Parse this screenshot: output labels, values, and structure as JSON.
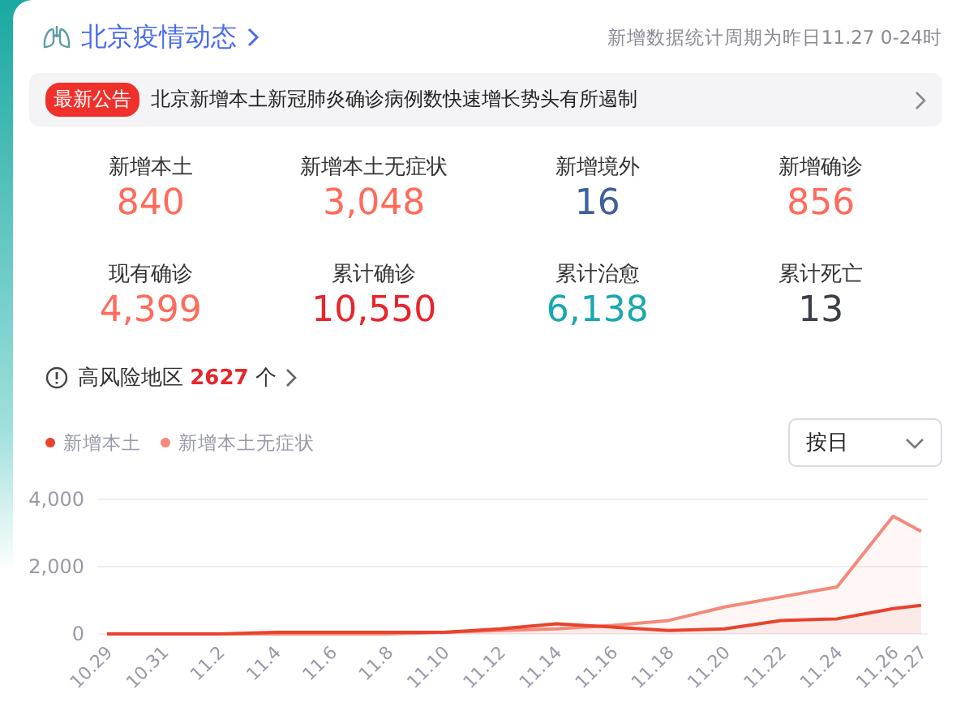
{
  "header": {
    "title": "北京疫情动态",
    "note": "新增数据统计周期为昨日11.27 0-24时"
  },
  "notice": {
    "badge": "最新公告",
    "text": "北京新增本土新冠肺炎确诊病例数快速增长势头有所遏制"
  },
  "stats": [
    {
      "label": "新增本土",
      "value": "840",
      "color": "#ff6b5b"
    },
    {
      "label": "新增本土无症状",
      "value": "3,048",
      "color": "#ff6b5b"
    },
    {
      "label": "新增境外",
      "value": "16",
      "color": "#3f5f9c"
    },
    {
      "label": "新增确诊",
      "value": "856",
      "color": "#ff6b5b"
    },
    {
      "label": "现有确诊",
      "value": "4,399",
      "color": "#ff6b5b"
    },
    {
      "label": "累计确诊",
      "value": "10,550",
      "color": "#e8252b"
    },
    {
      "label": "累计治愈",
      "value": "6,138",
      "color": "#1aa8b0"
    },
    {
      "label": "累计死亡",
      "value": "13",
      "color": "#3c3f4a"
    }
  ],
  "risk": {
    "label": "高风险地区",
    "count": "2627",
    "unit": "个"
  },
  "dropdown": {
    "value": "按日"
  },
  "chart_data": {
    "type": "area",
    "categories": [
      "10.29",
      "10.31",
      "11.2",
      "11.4",
      "11.6",
      "11.8",
      "11.10",
      "11.12",
      "11.14",
      "11.16",
      "11.18",
      "11.20",
      "11.22",
      "11.24",
      "11.26",
      "11.27"
    ],
    "yticks": [
      {
        "value": 0,
        "label": "0"
      },
      {
        "value": 2000,
        "label": "2,000"
      },
      {
        "value": 4000,
        "label": "4,000"
      }
    ],
    "ylim": [
      0,
      4000
    ],
    "series": [
      {
        "name": "新增本土",
        "color": "#e8432b",
        "values": [
          0,
          0,
          0,
          50,
          50,
          50,
          50,
          150,
          300,
          200,
          100,
          150,
          400,
          450,
          750,
          850
        ]
      },
      {
        "name": "新增本土无症状",
        "color": "#f4897a",
        "values": [
          0,
          0,
          0,
          0,
          0,
          0,
          50,
          100,
          150,
          250,
          400,
          800,
          1100,
          1400,
          3500,
          3050
        ]
      }
    ]
  }
}
